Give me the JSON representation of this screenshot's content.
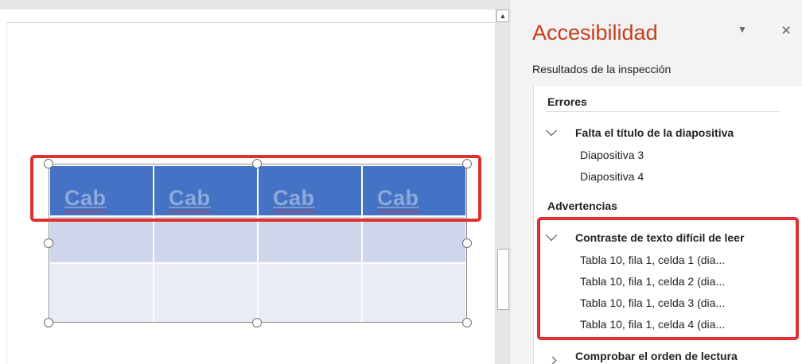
{
  "slide": {
    "table": {
      "header_cells": [
        "Cab",
        "Cab",
        "Cab",
        "Cab"
      ],
      "header_color": "#4472c4",
      "header_text_color": "#8ea9db",
      "row2_color": "#cfd5ea",
      "row3_color": "#e9ebf5"
    },
    "highlight_color": "#e03131"
  },
  "pane": {
    "title": "Accesibilidad",
    "title_color": "#c43e1c",
    "dropdown_icon": "▼",
    "close_icon": "×",
    "subtitle": "Resultados de la inspección",
    "errors": {
      "label": "Errores",
      "groups": [
        {
          "title": "Falta el título de la diapositiva",
          "items": [
            "Diapositiva 3",
            "Diapositiva 4"
          ]
        }
      ]
    },
    "warnings": {
      "label": "Advertencias",
      "groups": [
        {
          "title": "Contraste de texto difícil de leer",
          "items": [
            "Tabla 10, fila 1, celda 1 (dia...",
            "Tabla 10, fila 1, celda 2 (dia...",
            "Tabla 10, fila 1, celda 3 (dia...",
            "Tabla 10, fila 1, celda 4 (dia..."
          ]
        },
        {
          "title": "Comprobar el orden de lectura",
          "items": []
        }
      ]
    }
  },
  "scrollbar": {
    "up_arrow": "▲"
  }
}
